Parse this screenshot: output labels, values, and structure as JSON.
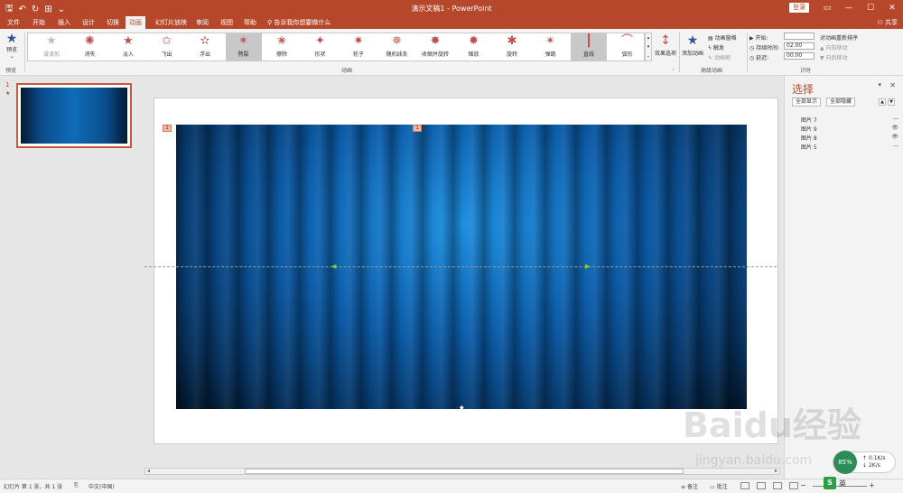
{
  "app": {
    "title": "演示文稿1  -  PowerPoint",
    "login": "登录",
    "share": "共享",
    "tell_me": "告诉我你想要做什么"
  },
  "tabs": [
    {
      "label": "文件"
    },
    {
      "label": "开始"
    },
    {
      "label": "插入"
    },
    {
      "label": "设计"
    },
    {
      "label": "切换"
    },
    {
      "label": "动画"
    },
    {
      "label": "幻灯片放映"
    },
    {
      "label": "审阅"
    },
    {
      "label": "视图"
    },
    {
      "label": "帮助"
    }
  ],
  "ribbon": {
    "preview_label": "预览",
    "preview_group": "预览",
    "animation_group": "动画",
    "advanced_group": "高级动画",
    "timing_group": "计时",
    "effects": [
      {
        "label": "波浪形",
        "dim": true
      },
      {
        "label": "消失",
        "dim": false
      },
      {
        "label": "淡入",
        "dim": false
      },
      {
        "label": "飞出",
        "dim": false
      },
      {
        "label": "浮出",
        "dim": false
      },
      {
        "label": "劈裂",
        "dim": false,
        "selected": true
      },
      {
        "label": "擦除",
        "dim": false
      },
      {
        "label": "形状",
        "dim": false
      },
      {
        "label": "轮子",
        "dim": false
      },
      {
        "label": "随机线条",
        "dim": false
      },
      {
        "label": "收缩并旋转",
        "dim": false
      },
      {
        "label": "缩放",
        "dim": false
      },
      {
        "label": "旋转",
        "dim": false
      },
      {
        "label": "弹跳",
        "dim": false
      },
      {
        "label": "直线",
        "dim": false,
        "selected": true
      },
      {
        "label": "弧形",
        "dim": false
      }
    ],
    "effect_options": "效果选项",
    "add_animation": "添加动画",
    "anim_pane": "动画窗格",
    "trigger": "触发",
    "anim_painter": "动画刷",
    "start_label": "开始:",
    "duration_label": "持续时间:",
    "duration_value": "02.00",
    "delay_label": "延迟:",
    "delay_value": "00.00",
    "reorder": "对动画重新排序",
    "move_earlier": "向前移动",
    "move_later": "向后移动"
  },
  "thumbs": {
    "slide_num": "1",
    "anim_mark": "★"
  },
  "slide": {
    "tag_left": "1",
    "tag_top": "1"
  },
  "pane": {
    "title": "选择",
    "show_all": "全部显示",
    "hide_all": "全部隐藏",
    "items": [
      {
        "name": "图片 7",
        "eye": "—"
      },
      {
        "name": "图片 9",
        "eye": "👁"
      },
      {
        "name": "图片 8",
        "eye": "👁"
      },
      {
        "name": "图片 5",
        "eye": "—"
      }
    ]
  },
  "status": {
    "slide_info": "幻灯片 第 1 张，共 1 张",
    "language": "中文(中国)",
    "notes": "备注",
    "comments": "批注"
  },
  "net": {
    "up": "0.1K/s",
    "down": "2K/s",
    "pct": "85%"
  },
  "ime": {
    "s": "S",
    "lang": "英"
  },
  "watermark": {
    "brand": "Baidu经验",
    "url": "jingyan.baidu.com"
  }
}
